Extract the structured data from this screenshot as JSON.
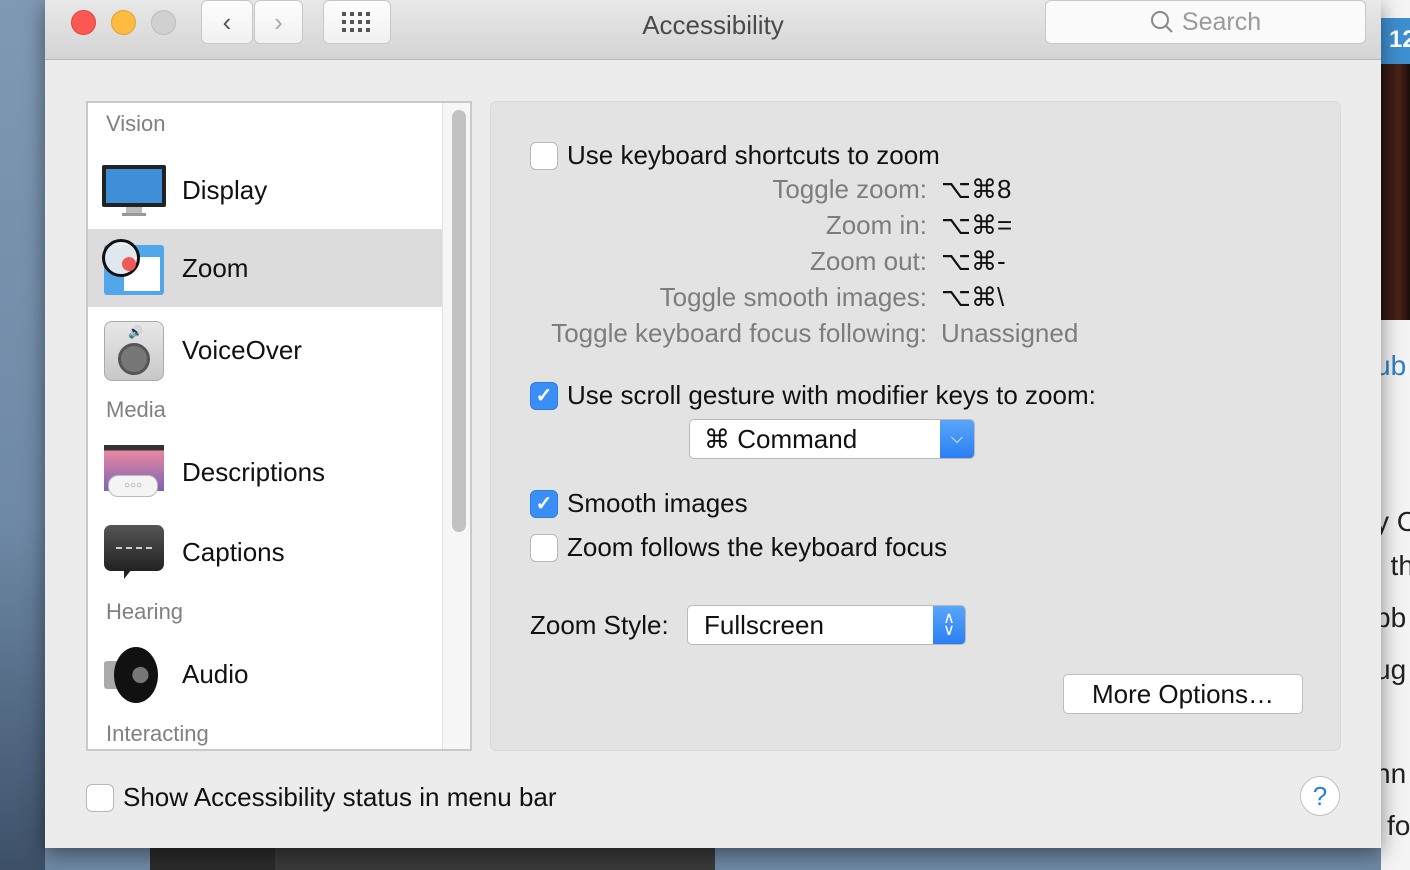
{
  "window": {
    "title": "Accessibility",
    "search_placeholder": "Search",
    "traffic_lights": {
      "close": "#fc5753",
      "minimize": "#fdbc40",
      "zoom": "#d0d0d0"
    }
  },
  "sidebar": {
    "sections": {
      "vision": "Vision",
      "media": "Media",
      "hearing": "Hearing",
      "interacting": "Interacting"
    },
    "items": [
      {
        "label": "Display",
        "icon": "display-icon"
      },
      {
        "label": "Zoom",
        "icon": "zoom-icon",
        "selected": true
      },
      {
        "label": "VoiceOver",
        "icon": "voiceover-icon"
      },
      {
        "label": "Descriptions",
        "icon": "descriptions-icon"
      },
      {
        "label": "Captions",
        "icon": "captions-icon"
      },
      {
        "label": "Audio",
        "icon": "audio-icon"
      }
    ]
  },
  "zoom_panel": {
    "keyboard_shortcuts": {
      "label": "Use keyboard shortcuts to zoom",
      "checked": false
    },
    "shortcuts": [
      {
        "label": "Toggle zoom:",
        "keys": "⌥⌘8"
      },
      {
        "label": "Zoom in:",
        "keys": "⌥⌘="
      },
      {
        "label": "Zoom out:",
        "keys": "⌥⌘-"
      },
      {
        "label": "Toggle smooth images:",
        "keys": "⌥⌘\\"
      },
      {
        "label": "Toggle keyboard focus following:",
        "keys": "Unassigned"
      }
    ],
    "scroll_gesture": {
      "label": "Use scroll gesture with modifier keys to zoom:",
      "checked": true
    },
    "modifier_select": {
      "value": "⌘ Command"
    },
    "smooth_images": {
      "label": "Smooth images",
      "checked": true
    },
    "follow_focus": {
      "label": "Zoom follows the keyboard focus",
      "checked": false
    },
    "zoom_style": {
      "label": "Zoom Style:",
      "value": "Fullscreen"
    },
    "more_options": "More Options…"
  },
  "footer": {
    "status_menu": {
      "label": "Show Accessibility status in menu bar",
      "checked": false
    },
    "help": "?"
  },
  "background_window": {
    "tab_text": "12",
    "fragments": [
      "ub",
      "y C",
      ", th",
      "bb",
      "ug",
      "nn",
      "fo"
    ],
    "accent": "#3d8fd0"
  }
}
